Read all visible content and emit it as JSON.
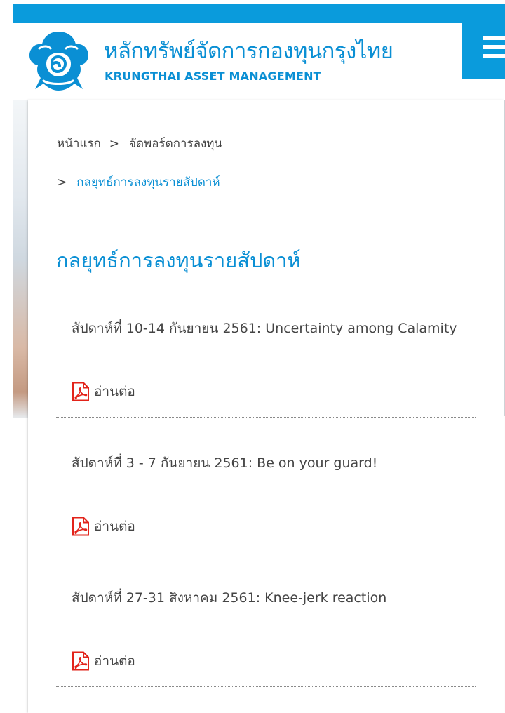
{
  "header": {
    "brand_thai": "หลักทรัพย์จัดการกองทุนกรุงไทย",
    "brand_english": "KRUNGTHAI ASSET MANAGEMENT",
    "logo_icon": "garuda-emblem-icon",
    "menu_icon": "hamburger-menu-icon",
    "brand_color": "#0a8fd4",
    "bar_color": "#0a9bdc"
  },
  "breadcrumb": {
    "separator": ">",
    "items": [
      {
        "label": "หน้าแรก"
      },
      {
        "label": "จัดพอร์ตการลงทุน"
      },
      {
        "label": "กลยุทธ์การลงทุนรายสัปดาห์"
      }
    ]
  },
  "page": {
    "title": "กลยุทธ์การลงทุนรายสัปดาห์"
  },
  "articles": [
    {
      "title": "สัปดาห์ที่ 10-14 กันยายน 2561: Uncertainty among Calamity",
      "read_more": "อ่านต่อ",
      "icon": "pdf-icon"
    },
    {
      "title": "สัปดาห์ที่ 3 - 7 กันยายน 2561: Be on your guard!",
      "read_more": "อ่านต่อ",
      "icon": "pdf-icon"
    },
    {
      "title": "สัปดาห์ที่ 27-31 สิงหาคม 2561: Knee-jerk reaction",
      "read_more": "อ่านต่อ",
      "icon": "pdf-icon"
    }
  ],
  "colors": {
    "pdf_red": "#e2231a",
    "text": "#444444"
  }
}
